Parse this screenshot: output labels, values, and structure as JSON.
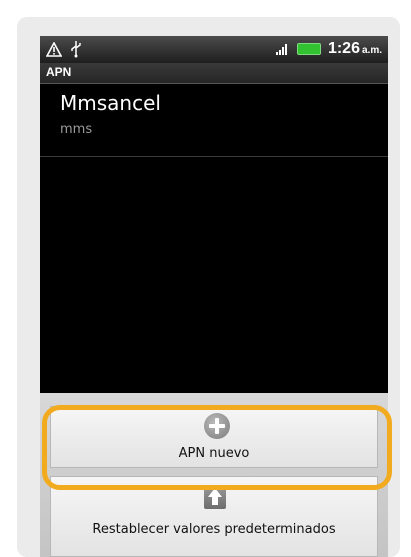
{
  "status_bar": {
    "time": "1:26",
    "ampm": "a.m.",
    "icons": [
      "warning-icon",
      "usb-icon",
      "signal-icon",
      "battery-icon"
    ]
  },
  "screen_title": "APN",
  "apn_list": [
    {
      "name": "Mmsancel",
      "type": "mms"
    }
  ],
  "menu": {
    "items": [
      {
        "label": "APN nuevo",
        "icon": "add-icon"
      },
      {
        "label": "Restablecer valores predeterminados",
        "icon": "reset-icon"
      }
    ]
  },
  "colors": {
    "highlight": "#f2ab1f",
    "battery": "#31c131"
  }
}
